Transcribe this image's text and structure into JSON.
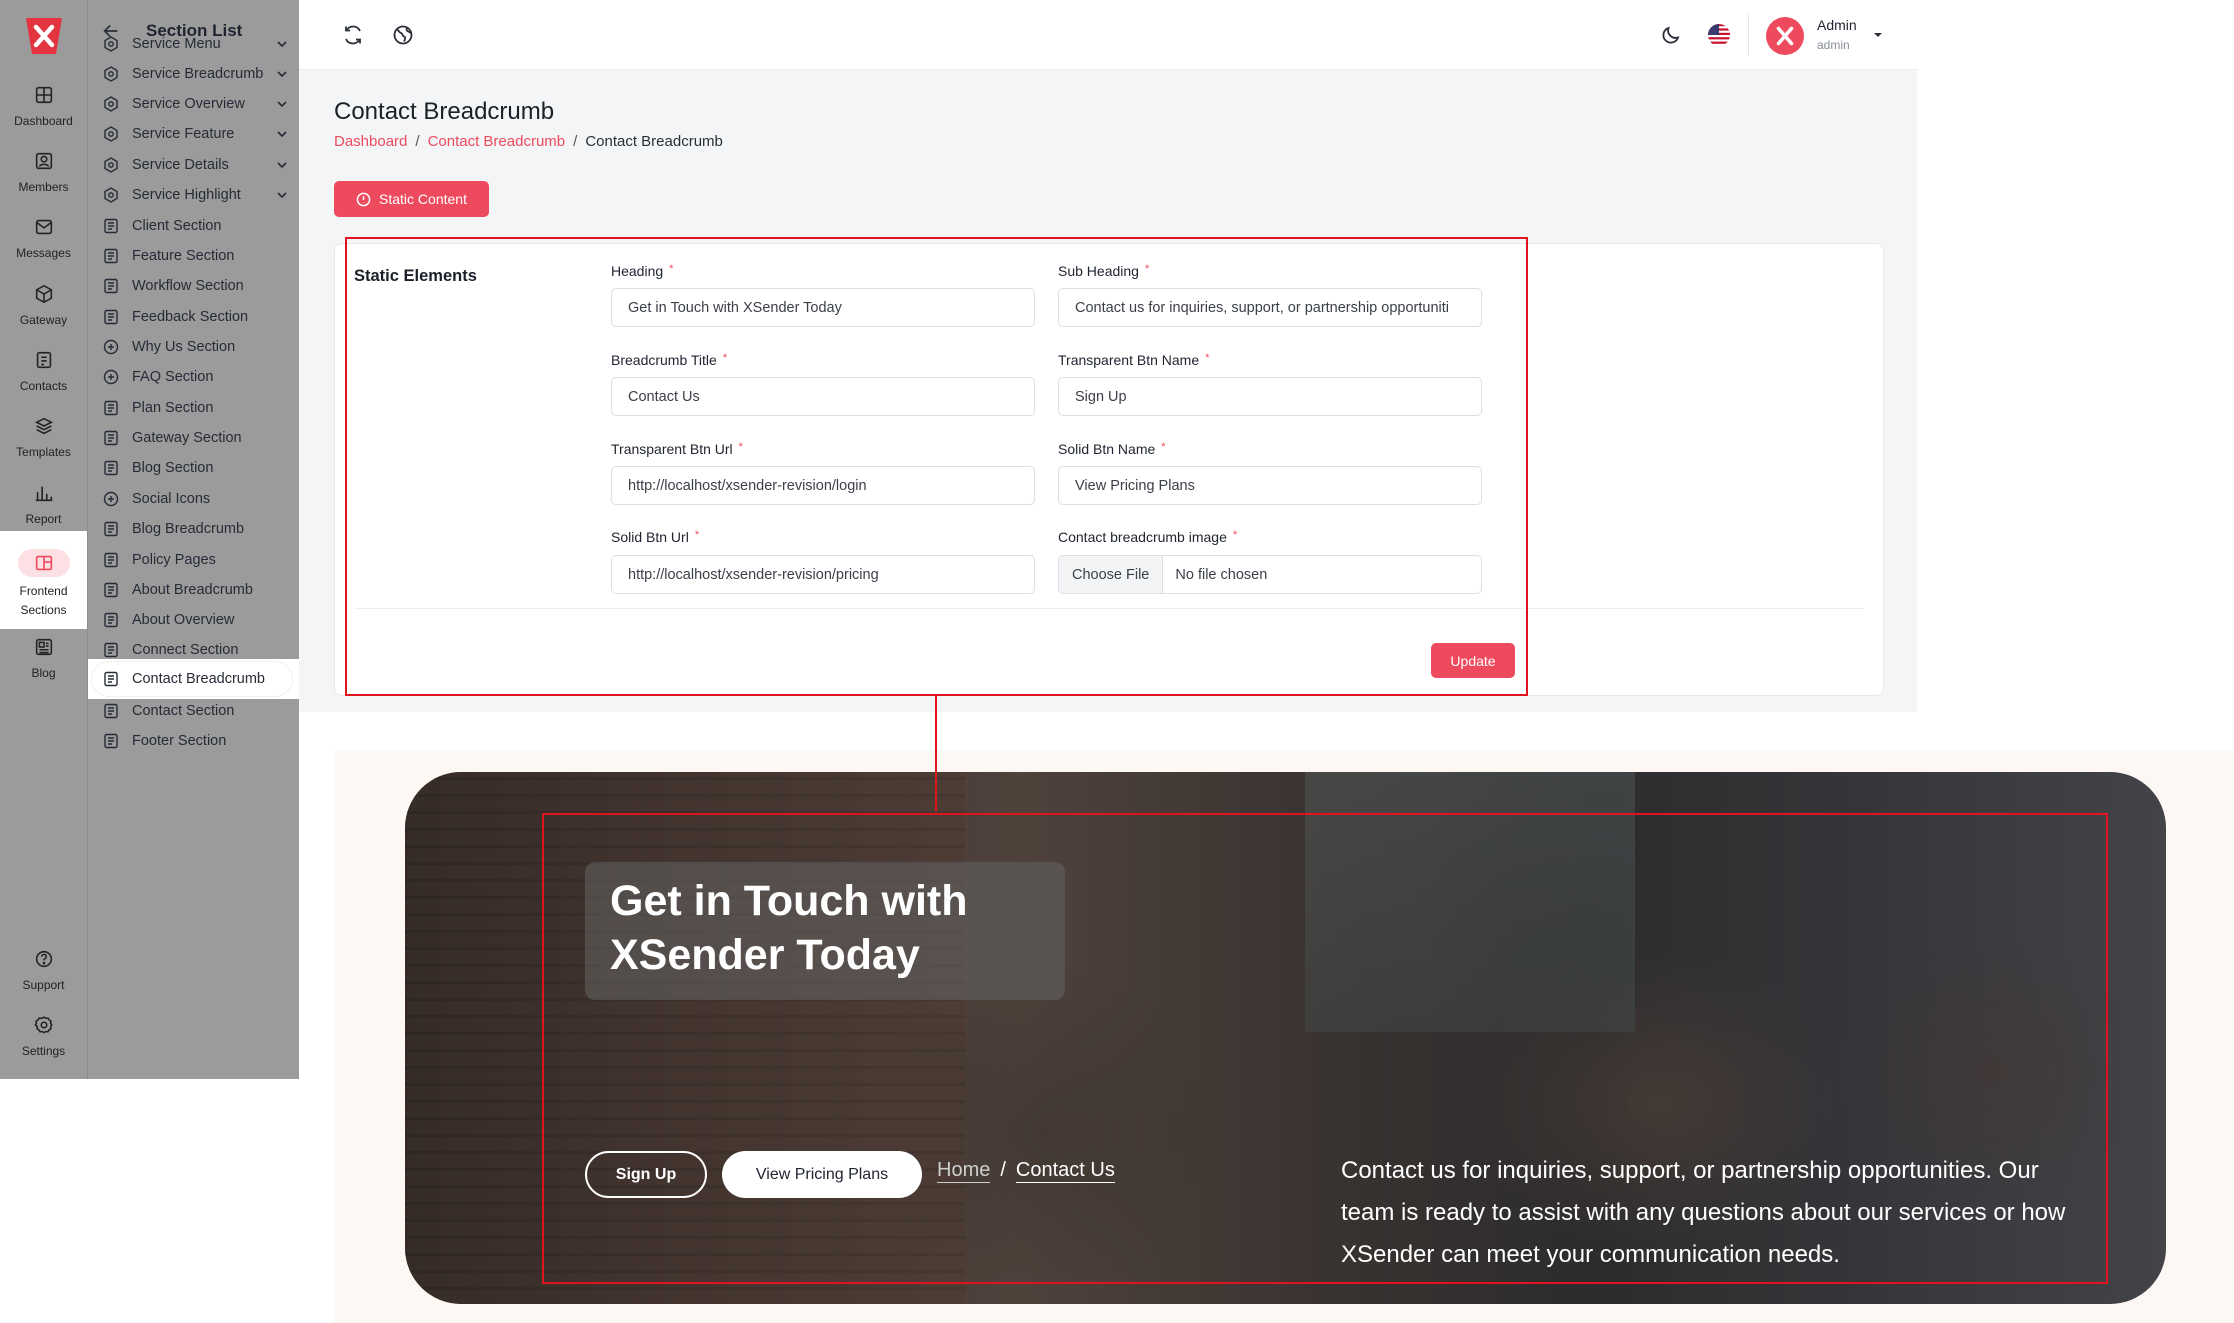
{
  "colors": {
    "accent": "#ee4a5e",
    "annotation": "#e0141f",
    "rail_bg": "#9b9b9b"
  },
  "rail": {
    "logo_icon": "xsender-logo",
    "items": [
      {
        "label": "Dashboard",
        "icon": "dashboard-icon"
      },
      {
        "label": "Members",
        "icon": "members-icon"
      },
      {
        "label": "Messages",
        "icon": "messages-icon"
      },
      {
        "label": "Gateway",
        "icon": "gateway-icon"
      },
      {
        "label": "Contacts",
        "icon": "contacts-icon"
      },
      {
        "label": "Templates",
        "icon": "templates-icon"
      },
      {
        "label": "Report",
        "icon": "report-icon"
      },
      {
        "label": "Frontend\nSections",
        "icon": "frontend-sections-icon"
      },
      {
        "label": "Blog",
        "icon": "blog-icon"
      },
      {
        "label": "Support",
        "icon": "support-icon"
      },
      {
        "label": "Settings",
        "icon": "settings-icon"
      }
    ]
  },
  "section_list": {
    "title": "Section List",
    "items": [
      {
        "label": "Service Menu"
      },
      {
        "label": "Service Breadcrumb"
      },
      {
        "label": "Service Overview"
      },
      {
        "label": "Service Feature"
      },
      {
        "label": "Service Details"
      },
      {
        "label": "Service Highlight"
      },
      {
        "label": "Client Section"
      },
      {
        "label": "Feature Section"
      },
      {
        "label": "Workflow Section"
      },
      {
        "label": "Feedback Section"
      },
      {
        "label": "Why Us Section"
      },
      {
        "label": "FAQ Section"
      },
      {
        "label": "Plan Section"
      },
      {
        "label": "Gateway Section"
      },
      {
        "label": "Blog Section"
      },
      {
        "label": "Social Icons"
      },
      {
        "label": "Blog Breadcrumb"
      },
      {
        "label": "Policy Pages"
      },
      {
        "label": "About Breadcrumb"
      },
      {
        "label": "About Overview"
      },
      {
        "label": "Connect Section"
      },
      {
        "label": "Contact Breadcrumb"
      },
      {
        "label": "Contact Section"
      },
      {
        "label": "Footer Section"
      }
    ],
    "active": "Contact Breadcrumb"
  },
  "topbar": {
    "user_name": "Admin",
    "user_role": "admin"
  },
  "page": {
    "title": "Contact Breadcrumb",
    "breadcrumb": [
      "Dashboard",
      "Contact Breadcrumb",
      "Contact Breadcrumb"
    ],
    "static_button": "Static Content",
    "card_title": "Static Elements",
    "fields": {
      "heading": {
        "label": "Heading",
        "value": "Get in Touch with XSender Today"
      },
      "sub_heading": {
        "label": "Sub Heading",
        "value": "Contact us for inquiries, support, or partnership opportuniti"
      },
      "breadcrumb_title": {
        "label": "Breadcrumb Title",
        "value": "Contact Us"
      },
      "transparent_btn_name": {
        "label": "Transparent Btn Name",
        "value": "Sign Up"
      },
      "transparent_btn_url": {
        "label": "Transparent Btn Url",
        "value": "http://localhost/xsender-revision/login"
      },
      "solid_btn_name": {
        "label": "Solid Btn Name",
        "value": "View Pricing Plans"
      },
      "solid_btn_url": {
        "label": "Solid Btn Url",
        "value": "http://localhost/xsender-revision/pricing"
      },
      "breadcrumb_image": {
        "label": "Contact breadcrumb image",
        "choose": "Choose File",
        "status": "No file chosen"
      }
    },
    "required_mark": "*",
    "update_button": "Update"
  },
  "preview": {
    "heading": "Get in Touch with XSender Today",
    "btn_outline": "Sign Up",
    "btn_solid": "View Pricing Plans",
    "crumb_home": "Home",
    "crumb_sep": "/",
    "crumb_current": "Contact Us",
    "subheading": "Contact us for inquiries, support, or partnership opportunities. Our team is ready to assist with any questions about our services or how XSender can meet your communication needs."
  }
}
